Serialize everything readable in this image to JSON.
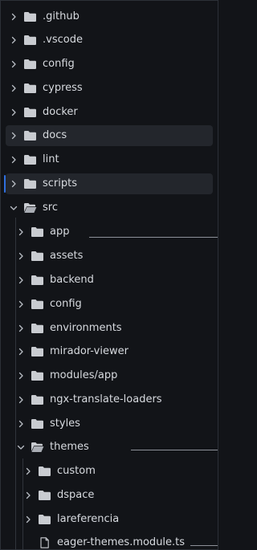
{
  "explorer": {
    "items": [
      {
        "label": ".github",
        "kind": "folder",
        "expanded": false
      },
      {
        "label": ".vscode",
        "kind": "folder",
        "expanded": false
      },
      {
        "label": "config",
        "kind": "folder",
        "expanded": false
      },
      {
        "label": "cypress",
        "kind": "folder",
        "expanded": false
      },
      {
        "label": "docker",
        "kind": "folder",
        "expanded": false
      },
      {
        "label": "docs",
        "kind": "folder",
        "expanded": false,
        "hovered": true
      },
      {
        "label": "lint",
        "kind": "folder",
        "expanded": false
      },
      {
        "label": "scripts",
        "kind": "folder",
        "expanded": false,
        "focused": true
      },
      {
        "label": "src",
        "kind": "folder",
        "expanded": true
      },
      {
        "label": "app",
        "kind": "folder",
        "expanded": false
      },
      {
        "label": "assets",
        "kind": "folder",
        "expanded": false
      },
      {
        "label": "backend",
        "kind": "folder",
        "expanded": false
      },
      {
        "label": "config",
        "kind": "folder",
        "expanded": false
      },
      {
        "label": "environments",
        "kind": "folder",
        "expanded": false
      },
      {
        "label": "mirador-viewer",
        "kind": "folder",
        "expanded": false
      },
      {
        "label": "modules/app",
        "kind": "folder",
        "expanded": false
      },
      {
        "label": "ngx-translate-loaders",
        "kind": "folder",
        "expanded": false
      },
      {
        "label": "styles",
        "kind": "folder",
        "expanded": false
      },
      {
        "label": "themes",
        "kind": "folder",
        "expanded": true
      },
      {
        "label": "custom",
        "kind": "folder",
        "expanded": false
      },
      {
        "label": "dspace",
        "kind": "folder",
        "expanded": false
      },
      {
        "label": "lareferencia",
        "kind": "folder",
        "expanded": false
      },
      {
        "label": "eager-themes.module.ts",
        "kind": "file"
      }
    ]
  },
  "colors": {
    "background": "#121418",
    "row_highlight": "#23262c",
    "folder_icon": "#c9ccd1",
    "focus_accent": "#2f6fde",
    "text": "#d7dadf"
  }
}
